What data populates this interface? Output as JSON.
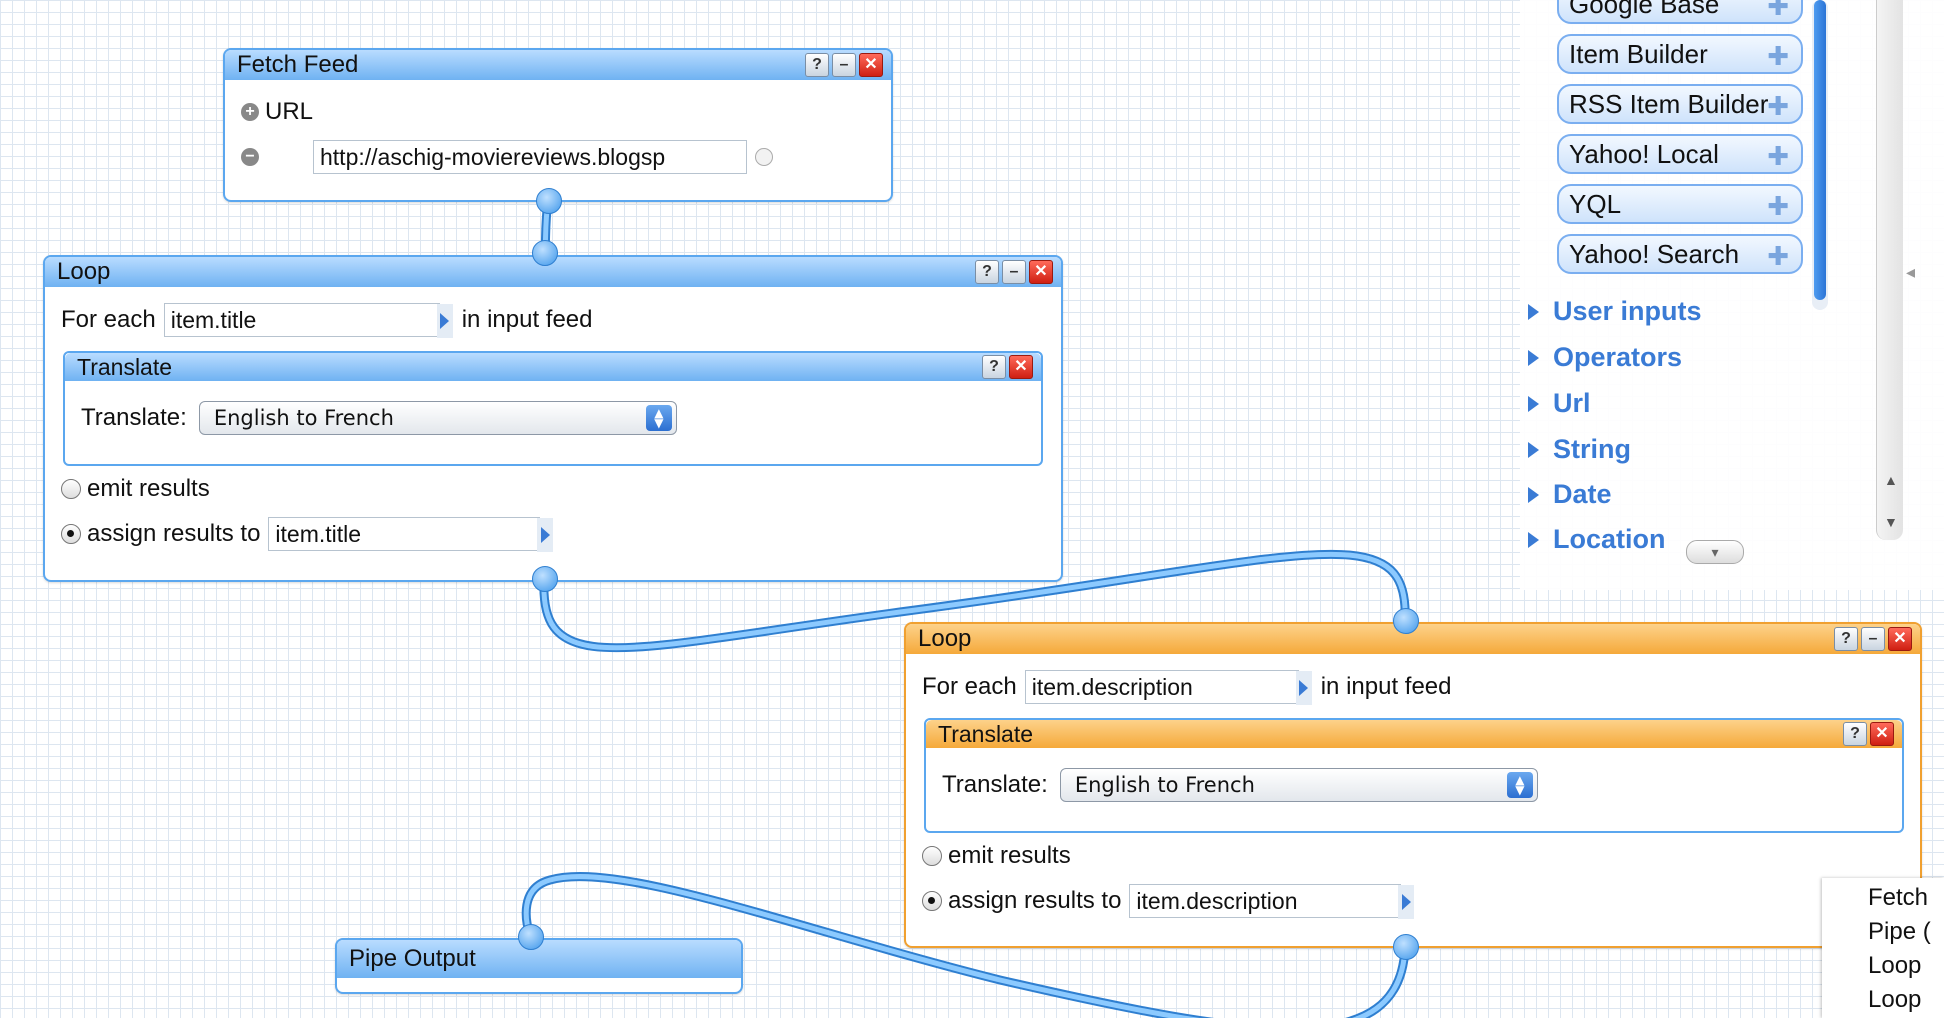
{
  "library": {
    "items": [
      {
        "label": "Google Base"
      },
      {
        "label": "Item Builder"
      },
      {
        "label": "RSS Item Builder"
      },
      {
        "label": "Yahoo! Local"
      },
      {
        "label": "YQL"
      },
      {
        "label": "Yahoo! Search"
      }
    ],
    "categories": [
      "User inputs",
      "Operators",
      "Url",
      "String",
      "Date",
      "Location"
    ]
  },
  "fetch_feed": {
    "title": "Fetch Feed",
    "url_label": "URL",
    "url_value": "http://aschig-moviereviews.blogsp"
  },
  "loop1": {
    "title": "Loop",
    "for_each": "For each",
    "field": "item.title",
    "in_input_feed": "in input feed",
    "translate_title": "Translate",
    "translate_label": "Translate:",
    "translate_value": "English to French",
    "emit_results": "emit results",
    "assign_results_to": "assign results to",
    "assign_field": "item.title"
  },
  "loop2": {
    "title": "Loop",
    "for_each": "For each",
    "field": "item.description",
    "in_input_feed": "in input feed",
    "translate_title": "Translate",
    "translate_label": "Translate:",
    "translate_value": "English to French",
    "emit_results": "emit results",
    "assign_results_to": "assign results to",
    "assign_field": "item.description"
  },
  "pipe_output": {
    "title": "Pipe Output"
  },
  "buttons": {
    "help": "?",
    "minimize": "–",
    "close": "✕"
  },
  "context_menu": {
    "items": [
      "Fetch",
      "Pipe (",
      "Loop",
      "Loop"
    ]
  },
  "colors": {
    "wire": "#6cb8f5",
    "module_border": "#5ba7ef",
    "selected_border": "#f0a030",
    "category_text": "#3a7bd5"
  }
}
